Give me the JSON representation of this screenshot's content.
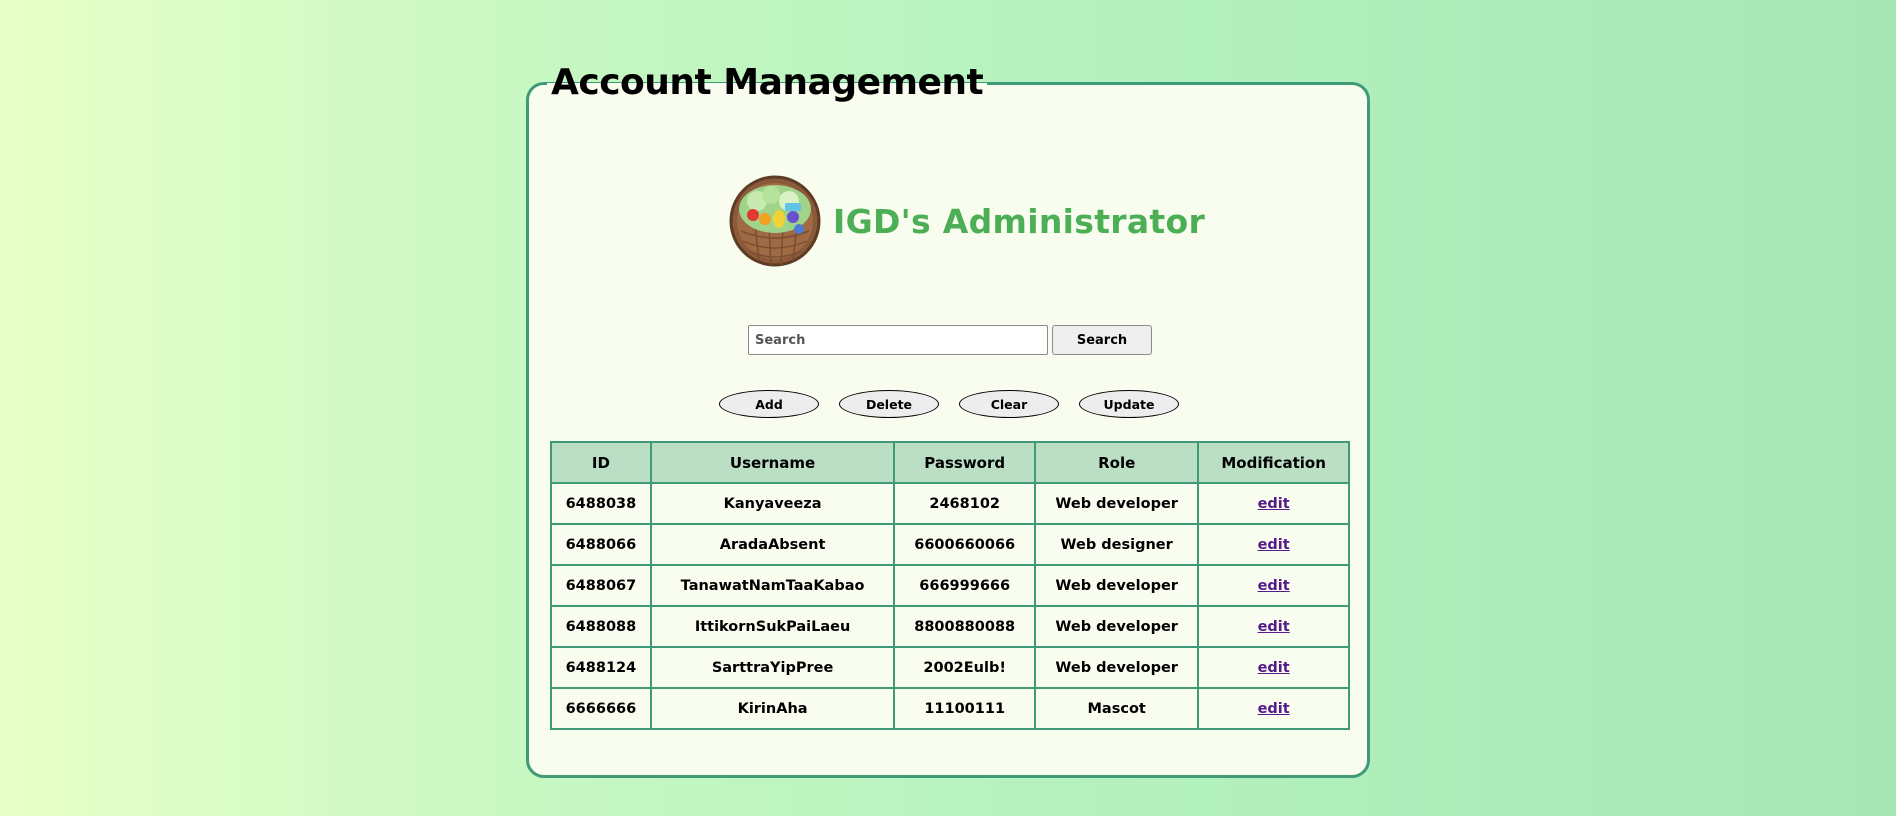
{
  "panel": {
    "title": "Account Management"
  },
  "brand": {
    "name": "IGD's Administrator",
    "logo_icon": "vegetable-basket-logo"
  },
  "search": {
    "placeholder": "Search",
    "value": "",
    "button_label": "Search"
  },
  "actions": {
    "add": "Add",
    "delete": "Delete",
    "clear": "Clear",
    "update": "Update"
  },
  "table": {
    "headers": [
      "ID",
      "Username",
      "Password",
      "Role",
      "Modification"
    ],
    "rows": [
      {
        "id": "6488038",
        "username": "Kanyaveeza",
        "password": "2468102",
        "role": "Web developer",
        "action": "edit"
      },
      {
        "id": "6488066",
        "username": "AradaAbsent",
        "password": "6600660066",
        "role": "Web designer",
        "action": "edit"
      },
      {
        "id": "6488067",
        "username": "TanawatNamTaaKabao",
        "password": "666999666",
        "role": "Web developer",
        "action": "edit"
      },
      {
        "id": "6488088",
        "username": "IttikornSukPaiLaeu",
        "password": "8800880088",
        "role": "Web developer",
        "action": "edit"
      },
      {
        "id": "6488124",
        "username": "SarttraYipPree",
        "password": "2002Eulb!",
        "role": "Web developer",
        "action": "edit"
      },
      {
        "id": "6666666",
        "username": "KirinAha",
        "password": "11100111",
        "role": "Mascot",
        "action": "edit"
      }
    ]
  },
  "colors": {
    "accent_green": "#4cae55",
    "border_green": "#3f9a77",
    "header_bg": "#badfc5",
    "link": "#551a8b"
  }
}
